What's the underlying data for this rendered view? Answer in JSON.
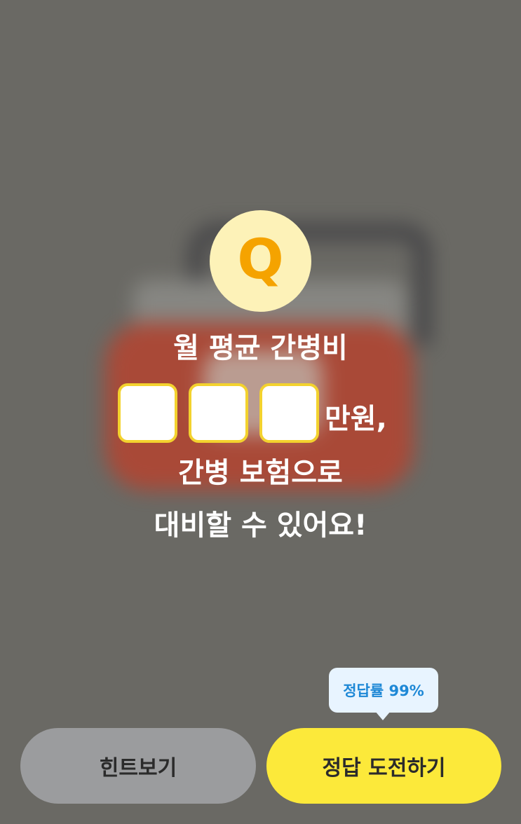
{
  "quiz": {
    "badge_letter": "Q",
    "line1": "월 평균 간병비",
    "blank_count": 3,
    "suffix": "만원,",
    "line3": "간병 보험으로",
    "line4": "대비할 수 있어요!"
  },
  "tooltip": {
    "text": "정답률 99%"
  },
  "buttons": {
    "hint_label": "힌트보기",
    "answer_label": "정답 도전하기"
  },
  "colors": {
    "background": "#6a6964",
    "badge_bg": "#fdf2b8",
    "badge_letter": "#f5a300",
    "blank_border": "#f3d22e",
    "hint_button": "#9b9c9e",
    "answer_button": "#fce93a",
    "tooltip_bg": "#e8f4ff",
    "tooltip_text": "#1e88d6"
  }
}
